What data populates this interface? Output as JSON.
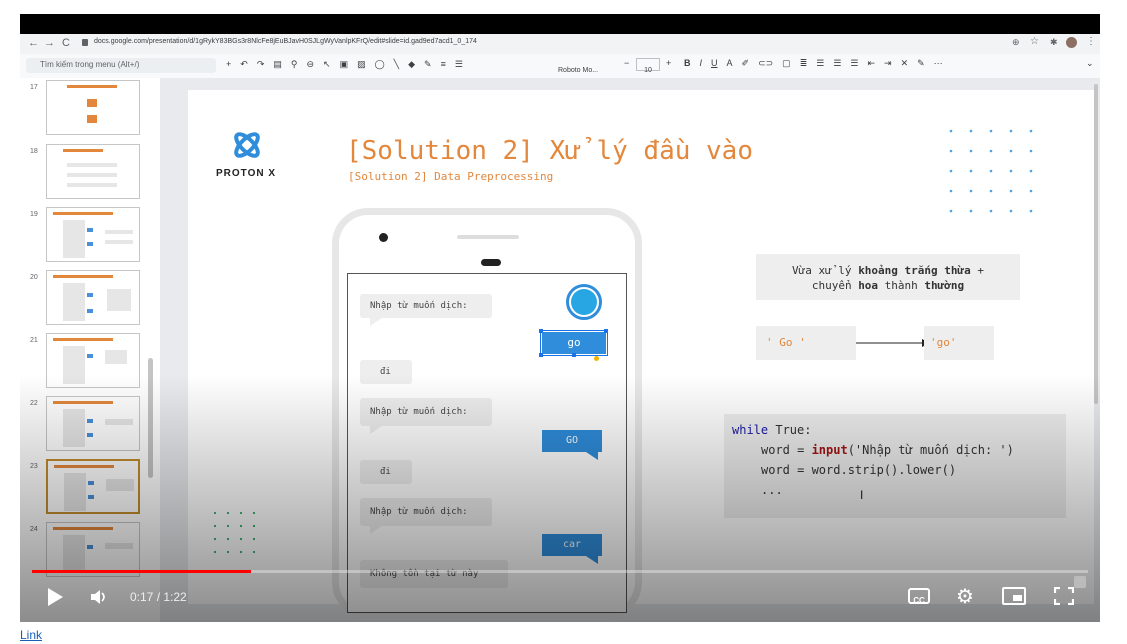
{
  "browser": {
    "url": "docs.google.com/presentation/d/1gRykY83BGs3r8NlcFe8jEuBJavH0SJLgWyVanlpKFrQ/edit#slide=id.gad9ed7acd1_0_174"
  },
  "toolbar": {
    "menu_search": "Tìm kiếm trong menu (Alt+/)",
    "font_name": "Roboto Mo...",
    "font_size": "10"
  },
  "filmstrip": {
    "slides": [
      {
        "num": "17"
      },
      {
        "num": "18"
      },
      {
        "num": "19"
      },
      {
        "num": "20"
      },
      {
        "num": "21"
      },
      {
        "num": "22"
      },
      {
        "num": "23"
      },
      {
        "num": "24"
      }
    ]
  },
  "slide": {
    "logo_text": "PROTON X",
    "title": "[Solution 2] Xử lý đầu vào",
    "subtitle": "[Solution 2] Data Preprocessing",
    "phone": {
      "chat": [
        {
          "side": "left",
          "text": "Nhập từ muốn dịch:"
        },
        {
          "side": "right",
          "text": "go"
        },
        {
          "side": "left",
          "text": "đi"
        },
        {
          "side": "left",
          "text": "Nhập từ muốn dịch:"
        },
        {
          "side": "right",
          "text": "GO"
        },
        {
          "side": "left",
          "text": "đi"
        },
        {
          "side": "left",
          "text": "Nhập từ muốn dịch:"
        },
        {
          "side": "right",
          "text": "car"
        },
        {
          "side": "left",
          "text": "Không tồn tại từ này"
        }
      ]
    },
    "note": {
      "line1_pre": "Vừa xử lý ",
      "line1_bold": "khoảng trắng thừa",
      "line1_post": " +",
      "line2_pre": "chuyển ",
      "line2_bold1": "hoa",
      "line2_mid": " thành ",
      "line2_bold2": "thường"
    },
    "transform": {
      "input": "' Go '",
      "output": "'go'"
    },
    "code": {
      "line1_kw": "while",
      "line1_rest": " True:",
      "line2_pre": "word = ",
      "line2_fn": "input",
      "line2_post": "('Nhập từ muốn dịch: ')",
      "line3": "word = word.strip().lower()",
      "line4": "..."
    },
    "cursor_glyph": "I"
  },
  "player": {
    "time": "0:17 / 1:22",
    "progress": 0.207,
    "cc_label": "CC"
  },
  "footer": {
    "link_text": "Link"
  },
  "colors": {
    "title_orange": "#e2873c",
    "chat_blue": "#2f8ddb",
    "progress_red": "#ff0000",
    "code_keyword": "#1a1aa6",
    "code_function": "#a31515"
  }
}
